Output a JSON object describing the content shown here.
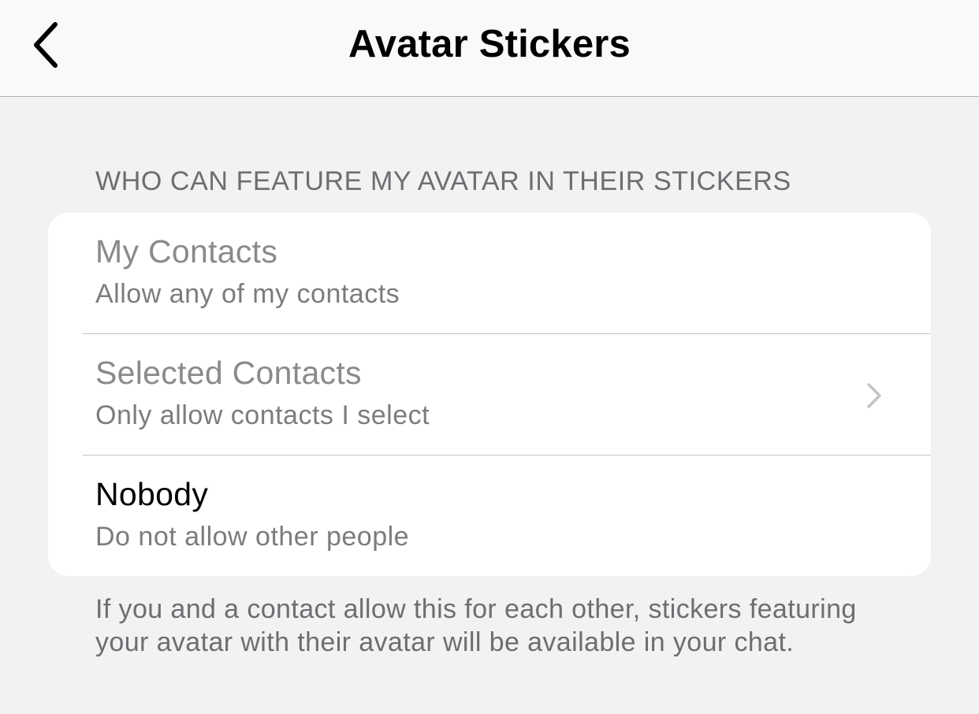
{
  "nav": {
    "title": "Avatar Stickers",
    "back_icon": "chevron-left-icon"
  },
  "section": {
    "header": "WHO CAN FEATURE MY AVATAR IN THEIR STICKERS"
  },
  "options": [
    {
      "title": "My Contacts",
      "subtitle": "Allow any of my contacts",
      "enabled": false
    },
    {
      "title": "Selected Contacts",
      "subtitle": "Only allow contacts I select",
      "enabled": false,
      "icon": "chevron-right-icon"
    },
    {
      "title": "Nobody",
      "subtitle": "Do not allow other people",
      "enabled": true
    }
  ],
  "footer": {
    "note": "If you and a contact allow this for each other, stickers featuring your avatar with their avatar will be available in your chat."
  },
  "colors": {
    "background": "#f2f2f2",
    "card": "#ffffff",
    "secondary_text": "#6d6d72",
    "disabled_text": "#8a8a8e"
  }
}
